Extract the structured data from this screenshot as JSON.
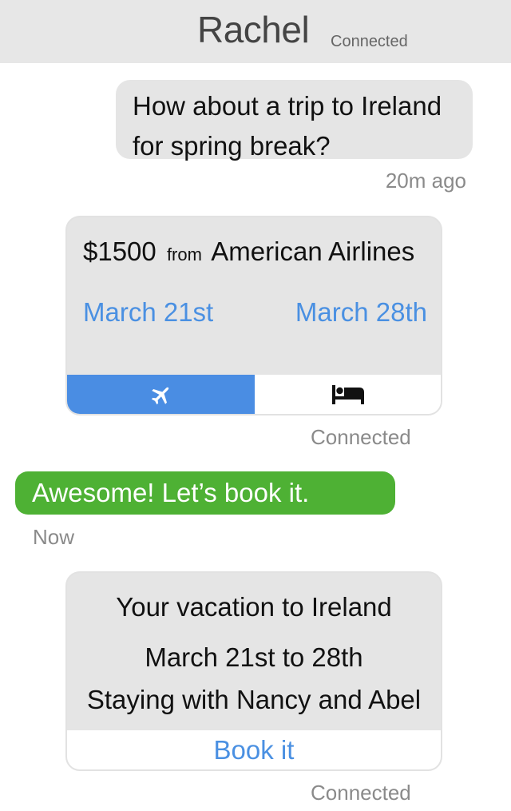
{
  "header": {
    "name": "Rachel",
    "status": "Connected"
  },
  "messages": {
    "incoming": {
      "line1": "How about a trip to Ireland",
      "line2": "for spring break?",
      "time": "20m ago"
    },
    "flight_card": {
      "price": "$1500",
      "from_word": "from",
      "airline": "American Airlines",
      "depart": "March 21st",
      "return": "March 28th",
      "tabs": [
        {
          "icon": "airplane-icon",
          "active": true
        },
        {
          "icon": "bed-icon",
          "active": false
        }
      ],
      "status": "Connected"
    },
    "outgoing": {
      "text": "Awesome! Let’s book it.",
      "time": "Now"
    },
    "summary_card": {
      "title": "Your vacation to Ireland",
      "dates": "March 21st to 28th",
      "staying": "Staying with Nancy and Abel",
      "action": "Book it",
      "status": "Connected"
    }
  },
  "colors": {
    "accent_blue": "#4a8de3",
    "bubble_green": "#4eb134",
    "bubble_gray": "#e5e5e5"
  }
}
